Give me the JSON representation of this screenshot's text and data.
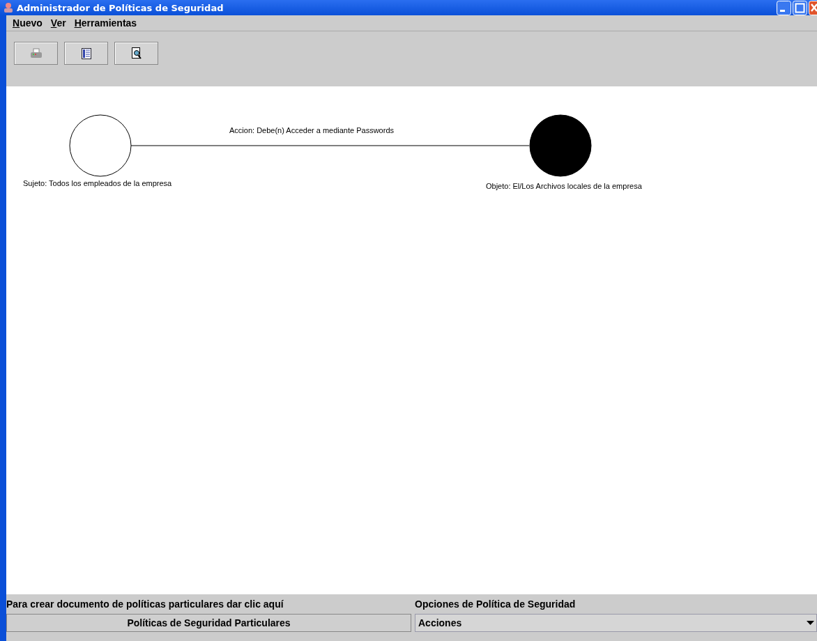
{
  "window": {
    "title": "Administrador de Políticas de Seguridad"
  },
  "menu": [
    {
      "label": "Nuevo"
    },
    {
      "label": "Ver"
    },
    {
      "label": "Herramientas"
    }
  ],
  "toolbar": [
    {
      "kind": "print"
    },
    {
      "kind": "list"
    },
    {
      "kind": "preview"
    }
  ],
  "diagram": {
    "action": "Accion: Debe(n)  Acceder a mediante Passwords",
    "nodes": [
      {
        "kind": "subject",
        "label": "Sujeto: Todos los empleados de la empresa"
      },
      {
        "kind": "object",
        "label": "Objeto: El/Los Archivos locales de la empresa"
      }
    ]
  },
  "footer": {
    "left_label": "Para crear documento de políticas particulares dar clic aquí",
    "button": "Políticas de Seguridad Particulares",
    "right_label": "Opciones de Política de Seguridad",
    "combo_value": "Acciones"
  }
}
